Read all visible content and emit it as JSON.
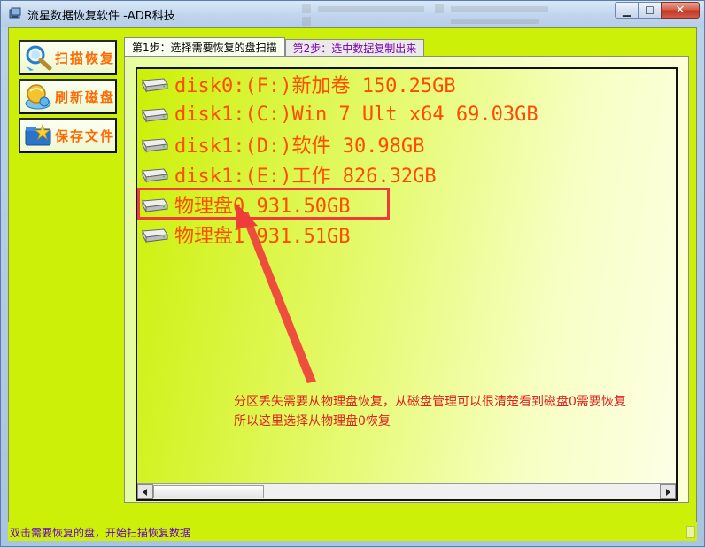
{
  "window": {
    "title": "流星数据恢复软件   -ADR科技",
    "min_label": "▁",
    "max_label": "☐",
    "close_label": "✕"
  },
  "sidebar": {
    "buttons": [
      {
        "label": "扫描恢复",
        "icon": "magnifier-icon"
      },
      {
        "label": "刷新磁盘",
        "icon": "globe-refresh-icon"
      },
      {
        "label": "保存文件",
        "icon": "save-folder-icon"
      }
    ]
  },
  "tabs": [
    {
      "label": "第1步：选择需要恢复的盘扫描",
      "active": true
    },
    {
      "label": "第2步：选中数据复制出来",
      "active": false
    }
  ],
  "disks": [
    {
      "label": "disk0:(F:)新加卷 150.25GB"
    },
    {
      "label": "disk1:(C:)Win 7 Ult x64 69.03GB"
    },
    {
      "label": "disk1:(D:)软件 30.98GB"
    },
    {
      "label": "disk1:(E:)工作 826.32GB"
    },
    {
      "label": "物理盘0 931.50GB"
    },
    {
      "label": "物理盘1 931.51GB"
    }
  ],
  "annotation": {
    "line1": "分区丢失需要从物理盘恢复，从磁盘管理可以很清楚看到磁盘0需要恢复",
    "line2": "所以这里选择从物理盘0恢复"
  },
  "status": {
    "text": "双击需要恢复的盘，开始扫描恢复数据"
  },
  "colors": {
    "panel_green": "#ccf007",
    "disk_text": "#ff4a00",
    "button_text": "#ff6a00",
    "annotation_red": "#e02020",
    "status_text": "#6a00c8"
  }
}
